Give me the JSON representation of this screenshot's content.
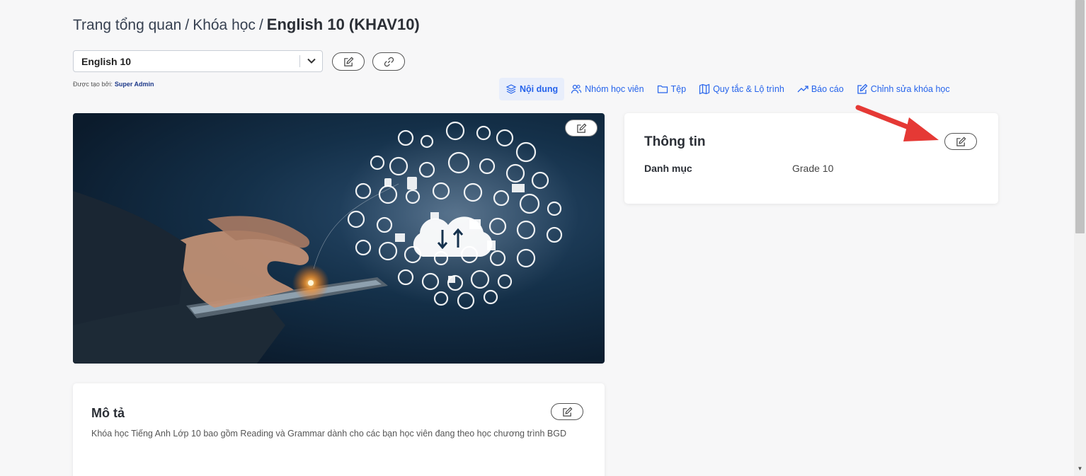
{
  "breadcrumb": {
    "items": [
      "Trang tổng quan",
      "Khóa học"
    ],
    "separator": "/",
    "current": "English 10 (KHAV10)"
  },
  "course_select": {
    "value": "English 10"
  },
  "created_by": {
    "label": "Được tạo bởi:",
    "name": "Super Admin"
  },
  "nav": {
    "tabs": [
      {
        "label": "Nội dung",
        "icon": "layers-icon",
        "active": true
      },
      {
        "label": "Nhóm học viên",
        "icon": "users-icon"
      },
      {
        "label": "Tệp",
        "icon": "folder-icon"
      },
      {
        "label": "Quy tắc & Lộ trình",
        "icon": "map-icon"
      },
      {
        "label": "Báo cáo",
        "icon": "trend-icon"
      },
      {
        "label": "Chỉnh sửa khóa học",
        "icon": "edit-icon"
      }
    ]
  },
  "info": {
    "title": "Thông tin",
    "category_label": "Danh mục",
    "category_value": "Grade 10"
  },
  "description": {
    "title": "Mô tả",
    "text": "Khóa học Tiếng Anh Lớp 10 bao gồm Reading và Grammar dành cho các bạn học viên đang theo học chương trình BGD"
  },
  "colors": {
    "accent": "#2563eb",
    "arrow": "#e53935"
  }
}
